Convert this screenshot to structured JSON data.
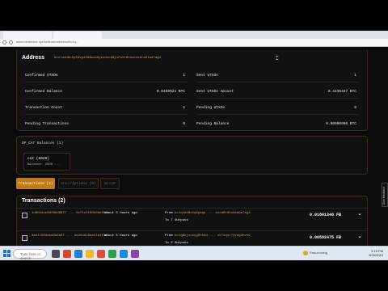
{
  "browser": {
    "url": "www.bestinslot.xyz/ordinals/address/bc1q..."
  },
  "address": {
    "title": "Address",
    "value": "bc1lu4d8c2p59vp4368mzm6yk4dvcd8jsPs0r0hhuc4e9ra8lwd7ag3"
  },
  "stats": [
    {
      "label": "Confirmed UTXOs",
      "value": "1"
    },
    {
      "label": "Sent UTXOs",
      "value": "1"
    },
    {
      "label": "Confirmed Balance",
      "value": "0.0489021 BTC"
    },
    {
      "label": "Sent UTXOs Amount",
      "value": "0.4435427 BTC"
    },
    {
      "label": "Transaction Count",
      "value": "2"
    },
    {
      "label": "Pending UTXOs",
      "value": "0"
    },
    {
      "label": "Pending Transactions",
      "value": "0"
    },
    {
      "label": "Pending Balance",
      "value": "0.00000000 BTC"
    }
  ],
  "balances": {
    "title": "OP_CAT Balances (1)",
    "token_name": "cat (8840)",
    "token_balance": "Balance: 2000 ..."
  },
  "tabs": [
    {
      "label": "Transactions (2)",
      "active": true
    },
    {
      "label": "Inscriptions (0)",
      "active": false
    },
    {
      "label": "Brc20",
      "active": false
    }
  ],
  "transactions": {
    "title": "Transactions (2)",
    "rows": [
      {
        "txid": "1d8b5dce89f8bd9977 ... 6cf1c5f90b0be8f2e",
        "time": "about 5 hours ago",
        "from_label": "From",
        "from_addr": "bc1q4dd8c2q9pmqa ... xccbRr0hu4ea9a7ag3",
        "outputs": "To 7 Outputs",
        "amount": "0.01801346 FB"
      },
      {
        "txid": "8ab1780daad6b6a07 ... aa30d9c8ea51b4f8f",
        "time": "about 5 hours ago",
        "from_label": "From",
        "from_addr": "bc1q8kjxunyg6hh4d ... xk7zqsr72vag4hvs9",
        "outputs": "To 2 Outputs",
        "amount": "0.00592475 FB"
      }
    ]
  },
  "feedback_label": "Give feedback",
  "taskbar": {
    "search_placeholder": "Type here to search",
    "weather": "Fast-moving",
    "time": "3:15 PM",
    "date": "9/25/2024"
  }
}
